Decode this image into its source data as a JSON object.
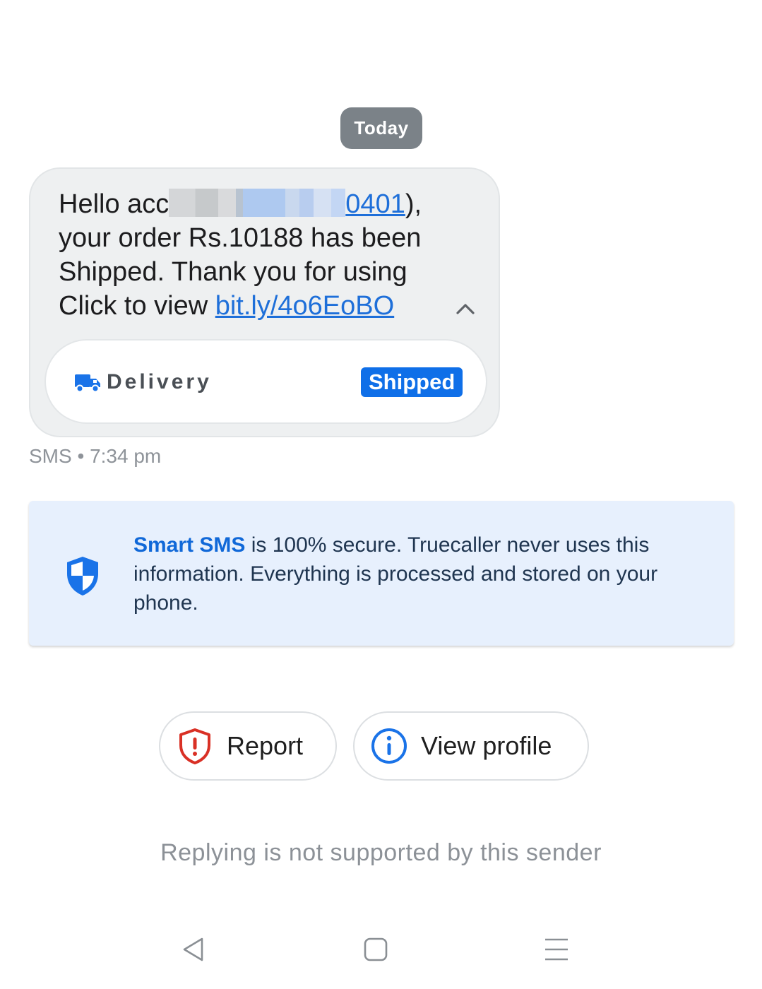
{
  "conversation": {
    "date_chip": "Today"
  },
  "message": {
    "line1_prefix": "Hello acc",
    "line1_link_tail": "0401",
    "line1_suffix": "),",
    "line2": "your order Rs.10188 has been",
    "line3": "Shipped. Thank you for using",
    "line4_prefix": "Click to view ",
    "link": "bit.ly/4o6EoBO",
    "collapse_icon": "chevron-up-icon",
    "channel": "SMS",
    "separator": "•",
    "time": "7:34 pm"
  },
  "delivery_card": {
    "icon": "truck-icon",
    "label": "Delivery",
    "status": "Shipped",
    "status_color": "#0f6fe8"
  },
  "secure_notice": {
    "icon": "shield-icon",
    "brand": "Smart SMS",
    "text": " is 100% secure. Truecaller never uses this information. Everything is processed and stored on your phone."
  },
  "actions": {
    "report": {
      "label": "Report",
      "icon": "report-shield-icon",
      "color": "#d93025"
    },
    "view_profile": {
      "label": "View profile",
      "icon": "info-icon",
      "color": "#1a73e8"
    }
  },
  "footer": {
    "reply_note": "Replying is not supported by this sender"
  },
  "navigation": {
    "back_icon": "back-triangle-icon",
    "home_icon": "home-square-icon",
    "menu_icon": "menu-lines-icon"
  }
}
